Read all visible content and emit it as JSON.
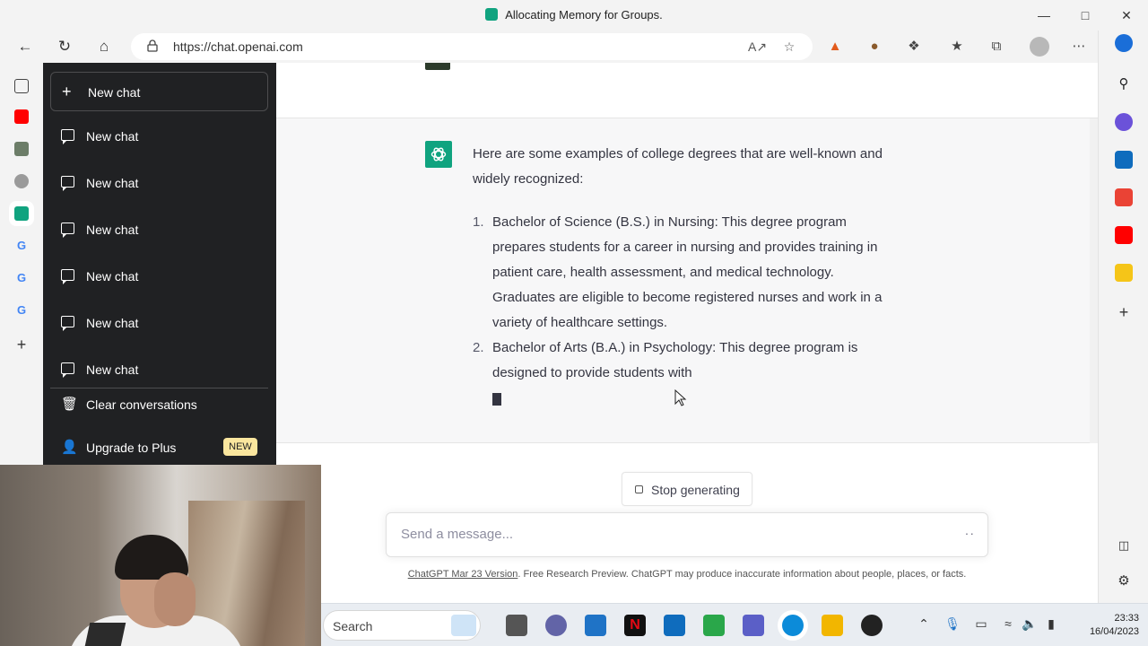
{
  "browser": {
    "tab_title": "Allocating Memory for Groups.",
    "url": "https://chat.openai.com",
    "window_controls": [
      "minimize-icon",
      "restore-icon",
      "close-icon"
    ],
    "colors": {
      "frame": "#f3f3f3"
    }
  },
  "sidebar": {
    "new_chat_label": "New chat",
    "conversations": [
      {
        "label": "New chat"
      },
      {
        "label": "New chat"
      },
      {
        "label": "New chat"
      },
      {
        "label": "New chat"
      },
      {
        "label": "New chat"
      },
      {
        "label": "New chat"
      }
    ],
    "clear_label": "Clear conversations",
    "upgrade_label": "Upgrade to Plus",
    "upgrade_badge": "NEW",
    "colors": {
      "background": "#202123",
      "badge": "#fae69e"
    }
  },
  "chat": {
    "intro": "Here are some examples of college degrees that are well-known and widely recognized:",
    "items": [
      {
        "number": "1.",
        "text": "Bachelor of Science (B.S.) in Nursing: This degree program prepares students for a career in nursing and provides training in patient care, health assessment, and medical technology. Graduates are eligible to become registered nurses and work in a variety of healthcare settings."
      },
      {
        "number": "2.",
        "text": "Bachelor of Arts (B.A.) in Psychology: This degree program is designed to provide students with"
      }
    ],
    "stop_label": "Stop generating",
    "input_placeholder": "Send a message...",
    "footer_version": "ChatGPT Mar 23 Version",
    "footer_text": ". Free Research Preview. ChatGPT may produce inaccurate information about people, places, or facts.",
    "colors": {
      "accent": "#10a37f",
      "assistant_bg": "#f7f7f8"
    }
  },
  "taskbar": {
    "search_label": "Search",
    "time": "23:33",
    "date": "16/04/2023"
  }
}
